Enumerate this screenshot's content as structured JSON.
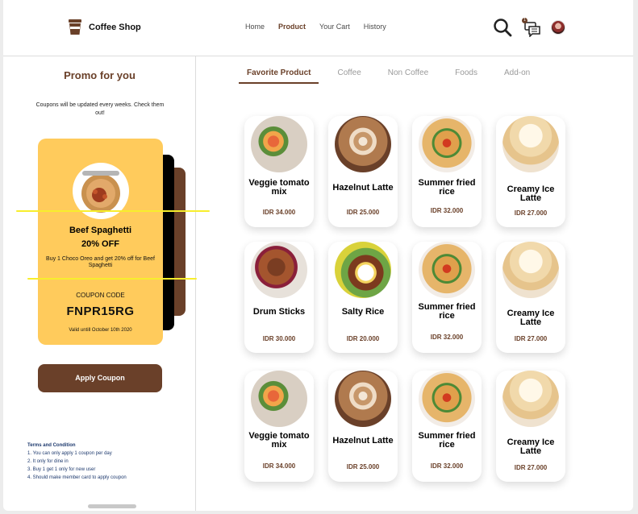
{
  "header": {
    "brand": "Coffee Shop",
    "nav": [
      "Home",
      "Product",
      "Your Cart",
      "History"
    ],
    "nav_active": "Product",
    "chat_badge": "1"
  },
  "promo": {
    "title": "Promo for you",
    "note": "Coupons will be updated every weeks. Check them out!",
    "coupon": {
      "name": "Beef Spaghetti",
      "discount": "20% OFF",
      "description": "Buy 1 Choco Oreo and get 20% off for Beef Spaghetti",
      "code_label": "COUPON CODE",
      "code": "FNPR15RG",
      "valid": "Valid untill October 10th 2020"
    },
    "apply_button": "Apply Coupon",
    "terms_title": "Terms and Condition",
    "terms": [
      "1. You can only apply 1 coupon per day",
      "2. It only for dine in",
      "3. Buy 1 get 1 only for new user",
      "4. Should make member card to apply coupon"
    ]
  },
  "tabs": [
    "Favorite Product",
    "Coffee",
    "Non Coffee",
    "Foods",
    "Add-on"
  ],
  "tab_active": "Favorite Product",
  "products": [
    {
      "name": "Veggie tomato mix",
      "price": "IDR 34.000",
      "image": "veggie"
    },
    {
      "name": "Hazelnut Latte",
      "price": "IDR 25.000",
      "image": "latte"
    },
    {
      "name": "Summer fried rice",
      "price": "IDR 32.000",
      "image": "rice"
    },
    {
      "name": "Creamy Ice Latte",
      "price": "IDR 27.000",
      "image": "cream"
    },
    {
      "name": "Drum Sticks",
      "price": "IDR 30.000",
      "image": "drum"
    },
    {
      "name": "Salty Rice",
      "price": "IDR 20.000",
      "image": "salty"
    },
    {
      "name": "Summer fried rice",
      "price": "IDR 32.000",
      "image": "rice"
    },
    {
      "name": "Creamy Ice Latte",
      "price": "IDR 27.000",
      "image": "cream"
    },
    {
      "name": "Veggie tomato mix",
      "price": "IDR 34.000",
      "image": "veggie"
    },
    {
      "name": "Hazelnut Latte",
      "price": "IDR 25.000",
      "image": "latte"
    },
    {
      "name": "Summer fried rice",
      "price": "IDR 32.000",
      "image": "rice"
    },
    {
      "name": "Creamy Ice Latte",
      "price": "IDR 27.000",
      "image": "cream"
    }
  ],
  "colors": {
    "brand": "#6a4029",
    "coupon": "#ffcb5c"
  }
}
